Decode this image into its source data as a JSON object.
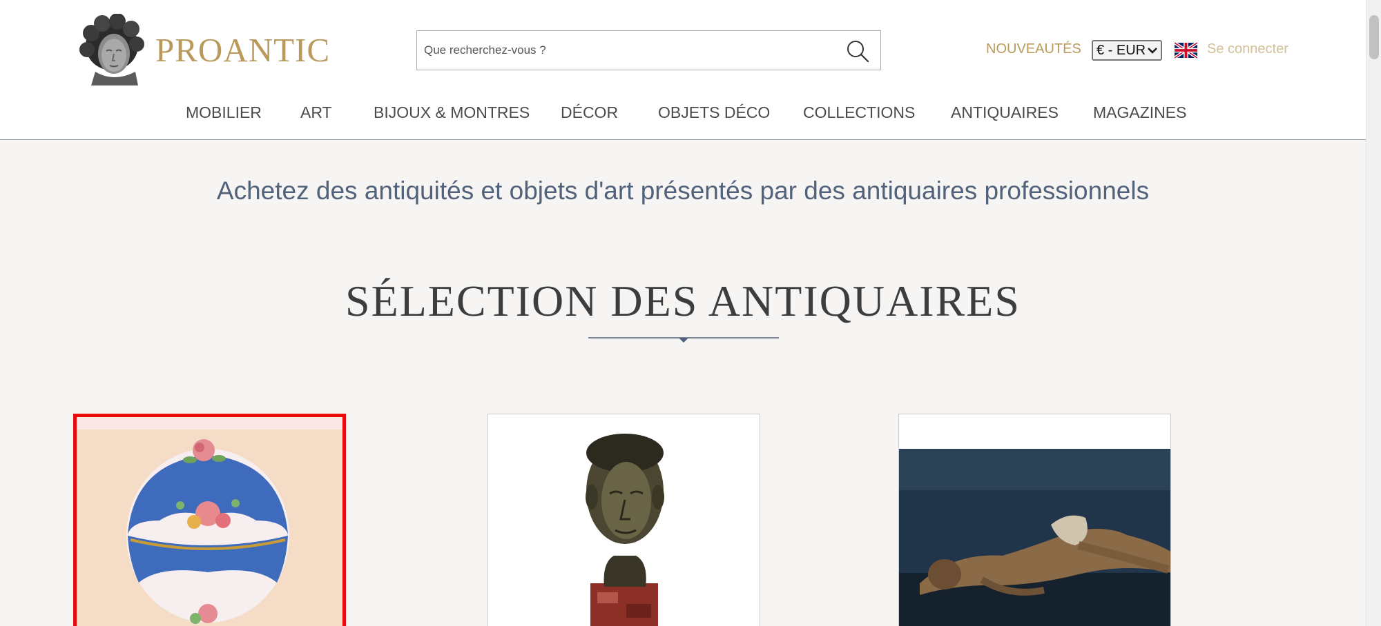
{
  "brand": {
    "name": "PROANTIC",
    "logo_icon": "bust-logo-icon"
  },
  "search": {
    "placeholder": "Que recherchez-vous ?"
  },
  "header": {
    "nouveautes_label": "NOUVEAUTÉS",
    "currency_value": "€ - EUR",
    "language_flag": "uk-flag-icon",
    "login_label": "Se connecter"
  },
  "nav": {
    "items": [
      {
        "label": "MOBILIER"
      },
      {
        "label": "ART"
      },
      {
        "label": "BIJOUX & MONTRES"
      },
      {
        "label": "DÉCOR"
      },
      {
        "label": "OBJETS DÉCO"
      },
      {
        "label": "COLLECTIONS"
      },
      {
        "label": "ANTIQUAIRES"
      },
      {
        "label": "MAGAZINES"
      }
    ]
  },
  "main": {
    "tagline": "Achetez des antiquités et objets d'art présentés par des antiquaires professionnels",
    "section_title": "SÉLECTION DES ANTIQUAIRES"
  },
  "products": [
    {
      "image": "porcelain-egg-box",
      "selected": true
    },
    {
      "image": "bronze-bust"
    },
    {
      "image": "reclining-figure-painting"
    }
  ],
  "colors": {
    "brand_gold": "#b99a5c",
    "tagline_blue": "#51627a",
    "selection_red": "#ea0a0a",
    "page_bg": "#f6f5f3"
  }
}
